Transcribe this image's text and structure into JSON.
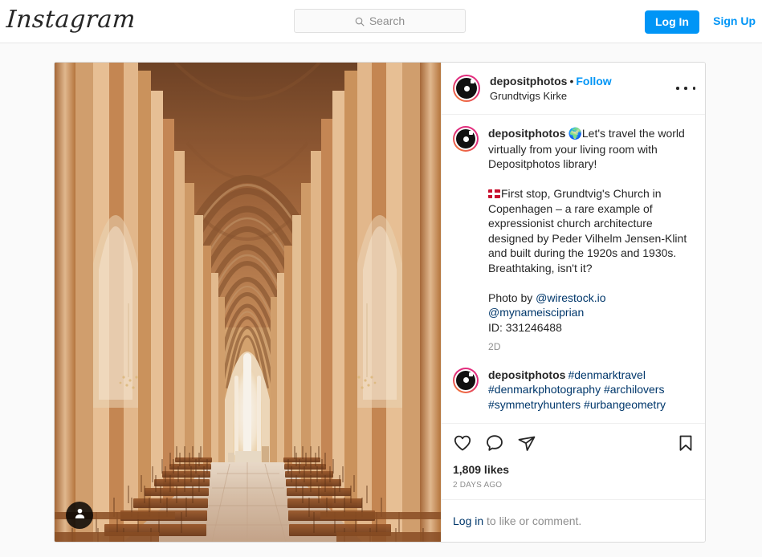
{
  "topbar": {
    "logo": "Instagram",
    "search": {
      "placeholder": "Search",
      "icon": "search-icon"
    },
    "login_label": "Log In",
    "signup_label": "Sign Up",
    "accent_color": "#0095f6"
  },
  "post": {
    "header": {
      "username": "depositphotos",
      "separator": "•",
      "follow_label": "Follow",
      "location": "Grundtvigs Kirke",
      "more_icon": "ellipsis-icon"
    },
    "media": {
      "alt": "Grundtvigs Kirke interior, Copenhagen",
      "tag_badge_icon": "person-icon"
    },
    "caption": {
      "username": "depositphotos",
      "paragraph1_emoji": "🌍",
      "paragraph1": "Let's travel the world virtually from your living room with Depositphotos library!",
      "paragraph2_flag": "denmark-flag",
      "paragraph2": "First stop, Grundtvig's Church in Copenhagen – a rare example of expressionist church architecture designed by Peder Vilhelm Jensen-Klint and built during the 1920s and 1930s. Breathtaking, isn't it?",
      "credit_prefix": "Photo by ",
      "credit_handle1": "@wirestock.io",
      "credit_handle2": "@mynameisciprian",
      "id_line": "ID: 331246488",
      "time_ago": "2d"
    },
    "comment": {
      "username": "depositphotos",
      "hashtags": "#denmarktravel #denmarkphotography #archilovers #symmetryhunters #urbangeometry"
    },
    "actions": {
      "like_icon": "heart-icon",
      "comment_icon": "comment-bubble-icon",
      "share_icon": "paper-plane-icon",
      "save_icon": "bookmark-icon",
      "likes_count": "1,809 likes",
      "posted_when": "2 DAYS AGO"
    },
    "footer": {
      "login_link": "Log in",
      "rest": " to like or comment."
    }
  }
}
